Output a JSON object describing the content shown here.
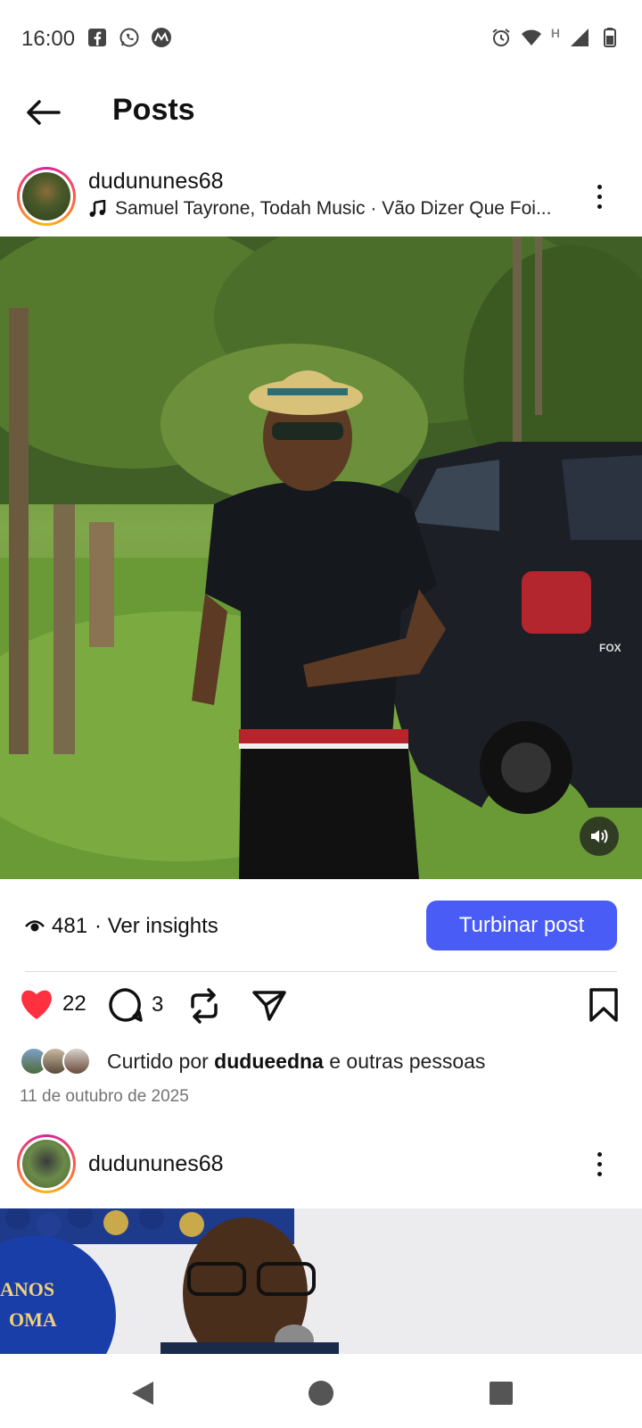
{
  "status_bar": {
    "time": "16:00",
    "left_icons": [
      "facebook-icon",
      "whatsapp-icon",
      "motorola-icon"
    ],
    "right_icons": [
      "alarm-icon",
      "wifi-icon",
      "network-h-icon",
      "signal-icon",
      "battery-icon"
    ],
    "network_label": "H"
  },
  "header": {
    "title": "Posts"
  },
  "post1": {
    "username": "dudununes68",
    "music": "Samuel Tayrone, Todah Music · Vão Dizer Que Foi...",
    "views": "481",
    "insights_label": "· Ver insights",
    "boost_label": "Turbinar post",
    "likes": "22",
    "comments": "3",
    "liked_by_prefix": "Curtido por",
    "liked_by_user": "dudueedna",
    "liked_by_suffix": "e outras pessoas",
    "date": "11 de outubro de 2025",
    "car_badge": "FOX"
  },
  "post2": {
    "username": "dudununes68",
    "banner_text_1": "ANOS",
    "banner_text_2": "OMA"
  },
  "colors": {
    "accent": "#4a5cf6",
    "like": "#ff3040",
    "muted": "#737373"
  }
}
